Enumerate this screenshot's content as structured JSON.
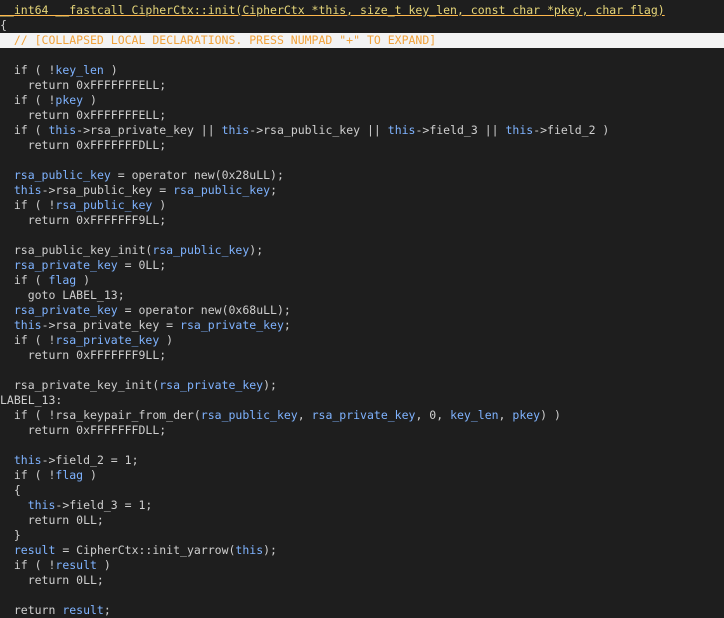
{
  "editor": {
    "lines": [
      {
        "id": "signature",
        "tokens": [
          {
            "t": "__int64 __fastcall CipherCtx::init(CipherCtx *this, size_t key_len, const char *pkey, char flag)",
            "c": "sig",
            "u": true
          }
        ]
      },
      {
        "id": "open-brace",
        "tokens": [
          {
            "t": "{",
            "c": "plain"
          }
        ]
      },
      {
        "id": "collapsed-declarations",
        "hl": true,
        "tokens": [
          {
            "t": "  // [COLLAPSED LOCAL DECLARATIONS. PRESS NUMPAD \"+\" TO EXPAND]",
            "c": "comment"
          }
        ]
      },
      {
        "id": "blank-1",
        "tokens": [
          {
            "t": "",
            "c": "plain"
          }
        ]
      },
      {
        "id": "if-key-len",
        "tokens": [
          {
            "t": "  if ( !",
            "c": "plain"
          },
          {
            "t": "key_len",
            "c": "var"
          },
          {
            "t": " )",
            "c": "plain"
          }
        ]
      },
      {
        "id": "ret-1",
        "tokens": [
          {
            "t": "    return 0xFFFFFFFELL;",
            "c": "plain"
          }
        ]
      },
      {
        "id": "if-pkey",
        "tokens": [
          {
            "t": "  if ( !",
            "c": "plain"
          },
          {
            "t": "pkey",
            "c": "var"
          },
          {
            "t": " )",
            "c": "plain"
          }
        ]
      },
      {
        "id": "ret-2",
        "tokens": [
          {
            "t": "    return 0xFFFFFFFELL;",
            "c": "plain"
          }
        ]
      },
      {
        "id": "if-fields",
        "tokens": [
          {
            "t": "  if ( ",
            "c": "plain"
          },
          {
            "t": "this",
            "c": "kw"
          },
          {
            "t": "->rsa_private_key || ",
            "c": "plain"
          },
          {
            "t": "this",
            "c": "kw"
          },
          {
            "t": "->rsa_public_key || ",
            "c": "plain"
          },
          {
            "t": "this",
            "c": "kw"
          },
          {
            "t": "->field_3 || ",
            "c": "plain"
          },
          {
            "t": "this",
            "c": "kw"
          },
          {
            "t": "->field_2 )",
            "c": "plain"
          }
        ]
      },
      {
        "id": "ret-3",
        "tokens": [
          {
            "t": "    return 0xFFFFFFFDLL;",
            "c": "plain"
          }
        ]
      },
      {
        "id": "blank-2",
        "tokens": [
          {
            "t": "",
            "c": "plain"
          }
        ]
      },
      {
        "id": "new-pub",
        "tokens": [
          {
            "t": "  ",
            "c": "plain"
          },
          {
            "t": "rsa_public_key",
            "c": "var"
          },
          {
            "t": " = operator new(0x28uLL);",
            "c": "plain"
          }
        ]
      },
      {
        "id": "assign-pub",
        "tokens": [
          {
            "t": "  ",
            "c": "plain"
          },
          {
            "t": "this",
            "c": "kw"
          },
          {
            "t": "->rsa_public_key = ",
            "c": "plain"
          },
          {
            "t": "rsa_public_key",
            "c": "var"
          },
          {
            "t": ";",
            "c": "plain"
          }
        ]
      },
      {
        "id": "if-pub",
        "tokens": [
          {
            "t": "  if ( !",
            "c": "plain"
          },
          {
            "t": "rsa_public_key",
            "c": "var"
          },
          {
            "t": " )",
            "c": "plain"
          }
        ]
      },
      {
        "id": "ret-4",
        "tokens": [
          {
            "t": "    return 0xFFFFFFF9LL;",
            "c": "plain"
          }
        ]
      },
      {
        "id": "blank-3",
        "tokens": [
          {
            "t": "",
            "c": "plain"
          }
        ]
      },
      {
        "id": "pub-init",
        "tokens": [
          {
            "t": "  rsa_public_key_init(",
            "c": "plain"
          },
          {
            "t": "rsa_public_key",
            "c": "var"
          },
          {
            "t": ");",
            "c": "plain"
          }
        ]
      },
      {
        "id": "priv-zero",
        "tokens": [
          {
            "t": "  ",
            "c": "plain"
          },
          {
            "t": "rsa_private_key",
            "c": "var"
          },
          {
            "t": " = 0LL;",
            "c": "plain"
          }
        ]
      },
      {
        "id": "if-flag",
        "tokens": [
          {
            "t": "  if ( ",
            "c": "plain"
          },
          {
            "t": "flag",
            "c": "var"
          },
          {
            "t": " )",
            "c": "plain"
          }
        ]
      },
      {
        "id": "goto",
        "tokens": [
          {
            "t": "    goto LABEL_13;",
            "c": "plain"
          }
        ]
      },
      {
        "id": "new-priv",
        "tokens": [
          {
            "t": "  ",
            "c": "plain"
          },
          {
            "t": "rsa_private_key",
            "c": "var"
          },
          {
            "t": " = operator new(0x68uLL);",
            "c": "plain"
          }
        ]
      },
      {
        "id": "assign-priv",
        "tokens": [
          {
            "t": "  ",
            "c": "plain"
          },
          {
            "t": "this",
            "c": "kw"
          },
          {
            "t": "->rsa_private_key = ",
            "c": "plain"
          },
          {
            "t": "rsa_private_key",
            "c": "var"
          },
          {
            "t": ";",
            "c": "plain"
          }
        ]
      },
      {
        "id": "if-priv",
        "tokens": [
          {
            "t": "  if ( !",
            "c": "plain"
          },
          {
            "t": "rsa_private_key",
            "c": "var"
          },
          {
            "t": " )",
            "c": "plain"
          }
        ]
      },
      {
        "id": "ret-5",
        "tokens": [
          {
            "t": "    return 0xFFFFFFF9LL;",
            "c": "plain"
          }
        ]
      },
      {
        "id": "blank-4",
        "tokens": [
          {
            "t": "",
            "c": "plain"
          }
        ]
      },
      {
        "id": "priv-init",
        "tokens": [
          {
            "t": "  rsa_private_key_init(",
            "c": "plain"
          },
          {
            "t": "rsa_private_key",
            "c": "var"
          },
          {
            "t": ");",
            "c": "plain"
          }
        ]
      },
      {
        "id": "label-13",
        "tokens": [
          {
            "t": "LABEL_13:",
            "c": "label"
          }
        ]
      },
      {
        "id": "if-keypair",
        "tokens": [
          {
            "t": "  if ( !rsa_keypair_from_der(",
            "c": "plain"
          },
          {
            "t": "rsa_public_key",
            "c": "var"
          },
          {
            "t": ", ",
            "c": "plain"
          },
          {
            "t": "rsa_private_key",
            "c": "var"
          },
          {
            "t": ", 0, ",
            "c": "plain"
          },
          {
            "t": "key_len",
            "c": "var"
          },
          {
            "t": ", ",
            "c": "plain"
          },
          {
            "t": "pkey",
            "c": "var"
          },
          {
            "t": ") )",
            "c": "plain"
          }
        ]
      },
      {
        "id": "ret-6",
        "tokens": [
          {
            "t": "    return 0xFFFFFFFDLL;",
            "c": "plain"
          }
        ]
      },
      {
        "id": "blank-5",
        "tokens": [
          {
            "t": "",
            "c": "plain"
          }
        ]
      },
      {
        "id": "field2",
        "tokens": [
          {
            "t": "  ",
            "c": "plain"
          },
          {
            "t": "this",
            "c": "kw"
          },
          {
            "t": "->field_2 = 1;",
            "c": "plain"
          }
        ]
      },
      {
        "id": "if-not-flag",
        "tokens": [
          {
            "t": "  if ( !",
            "c": "plain"
          },
          {
            "t": "flag",
            "c": "var"
          },
          {
            "t": " )",
            "c": "plain"
          }
        ]
      },
      {
        "id": "brace-open-2",
        "tokens": [
          {
            "t": "  {",
            "c": "plain"
          }
        ]
      },
      {
        "id": "field3",
        "tokens": [
          {
            "t": "    ",
            "c": "plain"
          },
          {
            "t": "this",
            "c": "kw"
          },
          {
            "t": "->field_3 = 1;",
            "c": "plain"
          }
        ]
      },
      {
        "id": "ret-7",
        "tokens": [
          {
            "t": "    return 0LL;",
            "c": "plain"
          }
        ]
      },
      {
        "id": "brace-close-2",
        "tokens": [
          {
            "t": "  }",
            "c": "plain"
          }
        ]
      },
      {
        "id": "result-assign",
        "tokens": [
          {
            "t": "  ",
            "c": "plain"
          },
          {
            "t": "result",
            "c": "var"
          },
          {
            "t": " = CipherCtx::init_yarrow(",
            "c": "plain"
          },
          {
            "t": "this",
            "c": "kw"
          },
          {
            "t": ");",
            "c": "plain"
          }
        ]
      },
      {
        "id": "if-result",
        "tokens": [
          {
            "t": "  if ( !",
            "c": "plain"
          },
          {
            "t": "result",
            "c": "var"
          },
          {
            "t": " )",
            "c": "plain"
          }
        ]
      },
      {
        "id": "ret-8",
        "tokens": [
          {
            "t": "    return 0LL;",
            "c": "plain"
          }
        ]
      },
      {
        "id": "blank-6",
        "tokens": [
          {
            "t": "",
            "c": "plain"
          }
        ]
      },
      {
        "id": "ret-result",
        "tokens": [
          {
            "t": "  return ",
            "c": "plain"
          },
          {
            "t": "result",
            "c": "var"
          },
          {
            "t": ";",
            "c": "plain"
          }
        ]
      }
    ]
  }
}
